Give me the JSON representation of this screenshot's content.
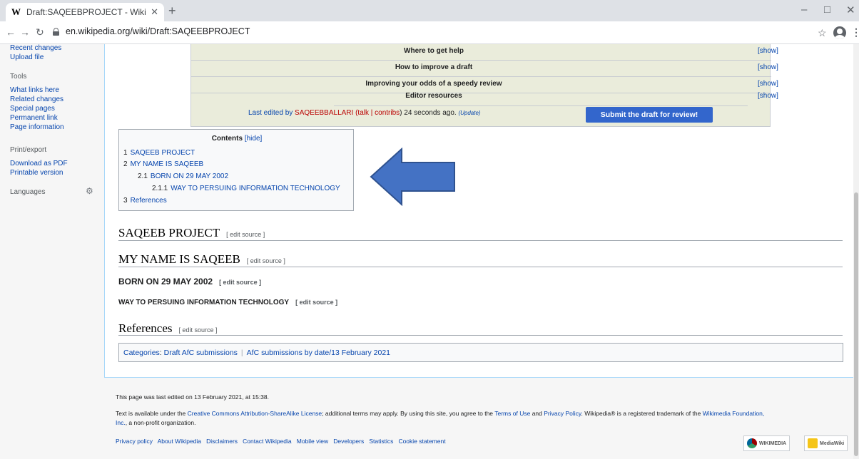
{
  "browser": {
    "tab_title": "Draft:SAQEEBPROJECT - Wikiped",
    "tab_logo": "W",
    "new_tab": "+",
    "url": "en.wikipedia.org/wiki/Draft:SAQEEBPROJECT",
    "icons": {
      "back": "←",
      "forward": "→",
      "reload": "↻",
      "star": "☆",
      "kebab": "⋮",
      "minimize": "–",
      "maximize": "□",
      "close": "✕",
      "tab_close": "✕"
    }
  },
  "sidebar": {
    "items": [
      {
        "label": "Recent changes",
        "type": "link"
      },
      {
        "label": "Upload file",
        "type": "link"
      },
      {
        "label": "Tools",
        "type": "heading"
      },
      {
        "label": "What links here",
        "type": "link"
      },
      {
        "label": "Related changes",
        "type": "link"
      },
      {
        "label": "Special pages",
        "type": "link"
      },
      {
        "label": "Permanent link",
        "type": "link"
      },
      {
        "label": "Page information",
        "type": "link"
      },
      {
        "label": "Print/export",
        "type": "heading"
      },
      {
        "label": "Download as PDF",
        "type": "link"
      },
      {
        "label": "Printable version",
        "type": "link"
      },
      {
        "label": "Languages",
        "type": "heading"
      }
    ],
    "gear_icon": "⚙"
  },
  "afc": {
    "rows": [
      {
        "title": "Where to get help",
        "action": "[show]"
      },
      {
        "title": "How to improve a draft",
        "action": "[show]"
      },
      {
        "title": "Improving your odds of a speedy review",
        "action": "[show]"
      },
      {
        "title": "Editor resources",
        "action": "[show]"
      }
    ],
    "footer": {
      "prefix": "Last edited by ",
      "user": "SAQEEBBALLARI",
      "open": " (",
      "talk": "talk",
      "pipe": " | ",
      "contribs": "contribs",
      "close": ") 24 seconds ago. ",
      "update": "(Update)"
    },
    "submit_label": "Submit the draft for review!"
  },
  "toc": {
    "title": "Contents",
    "hide": "[hide]",
    "entries": [
      {
        "num": "1",
        "label": "SAQEEB PROJECT"
      },
      {
        "num": "2",
        "label": "MY NAME IS SAQEEB"
      },
      {
        "num": "2.1",
        "label": "BORN ON 29 MAY 2002"
      },
      {
        "num": "2.1.1",
        "label": "WAY TO PERSUING INFORMATION TECHNOLOGY"
      },
      {
        "num": "3",
        "label": "References"
      }
    ]
  },
  "sections": {
    "s1": "SAQEEB PROJECT",
    "s2": "MY NAME IS SAQEEB",
    "s3": "BORN ON 29 MAY 2002",
    "s4": "WAY TO PERSUING INFORMATION TECHNOLOGY",
    "s5": "References",
    "edit_label": "[ edit source ]"
  },
  "categories": {
    "label": "Categories",
    "colon": ": ",
    "items": [
      "Draft AfC submissions",
      "AfC submissions by date/13 February 2021"
    ],
    "sep": "|"
  },
  "footer": {
    "last_edited": "This page was last edited on 13 February 2021, at 15:38.",
    "license_1": "Text is available under the ",
    "license_link": "Creative Commons Attribution-ShareAlike License",
    "license_2": "; additional terms may apply. By using this site, you agree to the ",
    "terms": "Terms of Use",
    "and": " and ",
    "privacy": "Privacy Policy",
    "license_3": ". Wikipedia® is a registered trademark of the ",
    "foundation": "Wikimedia Foundation,",
    "foundation_2": "Inc.",
    "license_4": ", a non-profit organization.",
    "links": [
      "Privacy policy",
      "About Wikipedia",
      "Disclaimers",
      "Contact Wikipedia",
      "Mobile view",
      "Developers",
      "Statistics",
      "Cookie statement"
    ],
    "badge_wikimedia": "WIKIMEDIA",
    "badge_mediawiki": "MediaWiki"
  },
  "colors": {
    "link": "#0645ad",
    "red_link": "#ba0000",
    "submit": "#3366cc",
    "arrow": "#4472c4",
    "afc_bg": "#eaecdb"
  }
}
